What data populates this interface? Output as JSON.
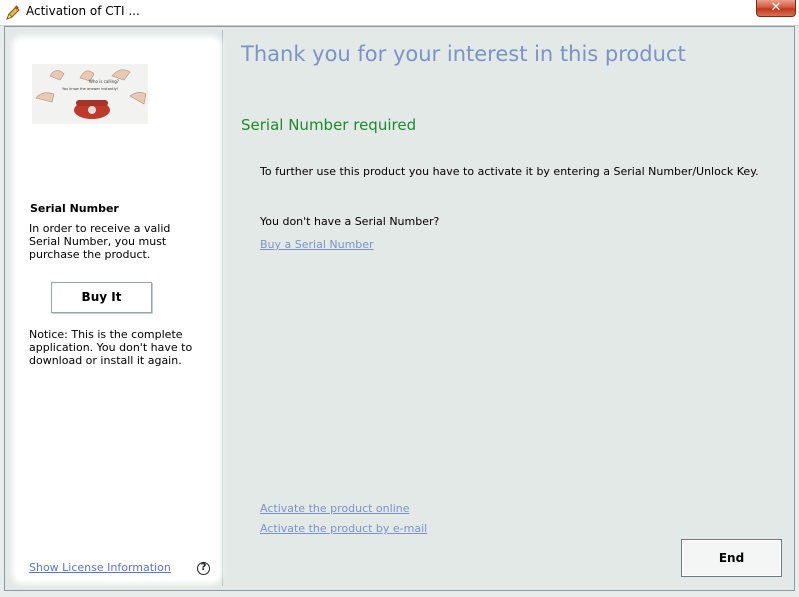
{
  "window": {
    "title": "Activation of CTI ...",
    "close_label": "✕"
  },
  "sidebar": {
    "promo_caption_line1": "Who is calling?",
    "promo_caption_line2": "You know the answer instantly!",
    "serial_heading": "Serial Number",
    "serial_description": "In order to receive a valid Serial Number, you must purchase the product.",
    "buy_button_label": "Buy It",
    "notice_text": "Notice: This is the complete application. You don't have to download or install it again.",
    "license_link": "Show License Information",
    "help_label": "?"
  },
  "main": {
    "title": "Thank you for your interest in this product",
    "subtitle": "Serial Number required",
    "instruction": "To further use this product you have to activate it by entering a Serial Number/Unlock Key.",
    "no_serial_question": "You don't have a Serial Number?",
    "buy_serial_link": "Buy a Serial Number",
    "activate_online_link": "Activate the product online",
    "activate_email_link": "Activate the product by e-mail",
    "end_button_label": "End"
  },
  "colors": {
    "title_blue": "#7b93c8",
    "subtitle_green": "#1f8a2c",
    "link_blue": "#7b93c8",
    "close_red": "#c0391b"
  },
  "icons": {
    "app_icon": "pencil-key-icon",
    "help_icon": "question-circle-icon"
  }
}
